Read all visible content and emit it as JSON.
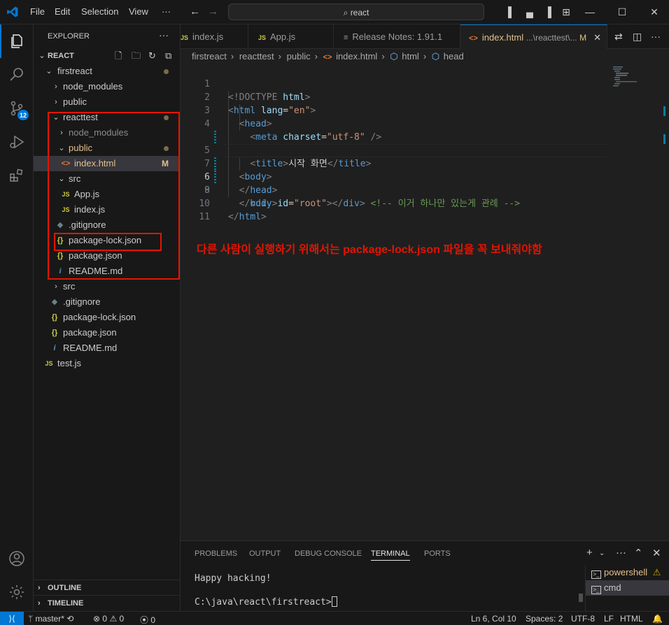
{
  "menu": {
    "file": "File",
    "edit": "Edit",
    "selection": "Selection",
    "view": "View",
    "more": "···"
  },
  "command_center": {
    "text": "react"
  },
  "explorer": {
    "header": "EXPLORER",
    "root": "REACT",
    "tree": [
      {
        "label": "firstreact",
        "dot": true
      },
      {
        "label": "node_modules"
      },
      {
        "label": "public"
      },
      {
        "label": "reacttest",
        "dot": true
      },
      {
        "label": "node_modules"
      },
      {
        "label": "public",
        "dot": true
      },
      {
        "label": "index.html",
        "badge": "M",
        "icon": "<>"
      },
      {
        "label": "src"
      },
      {
        "label": "App.js",
        "icon": "JS"
      },
      {
        "label": "index.js",
        "icon": "JS"
      },
      {
        "label": ".gitignore"
      },
      {
        "label": "package-lock.json",
        "icon": "{}"
      },
      {
        "label": "package.json",
        "icon": "{}"
      },
      {
        "label": "README.md",
        "icon": "i"
      },
      {
        "label": "src"
      },
      {
        "label": ".gitignore"
      },
      {
        "label": "package-lock.json",
        "icon": "{}"
      },
      {
        "label": "package.json",
        "icon": "{}"
      },
      {
        "label": "README.md",
        "icon": "i"
      },
      {
        "label": "test.js",
        "icon": "JS"
      }
    ],
    "outline": "OUTLINE",
    "timeline": "TIMELINE"
  },
  "tabs": [
    {
      "label": "index.js",
      "icon": "JS"
    },
    {
      "label": "App.js",
      "icon": "JS"
    },
    {
      "label": "Release Notes: 1.91.1",
      "icon": "≡"
    },
    {
      "label": "index.html",
      "icon": "<>",
      "path": "...\\reacttest\\...",
      "badge": "M"
    }
  ],
  "breadcrumb": [
    "firstreact",
    "reacttest",
    "public",
    "index.html",
    "html",
    "head"
  ],
  "editor": {
    "line_numbers": [
      "1",
      "2",
      "3",
      "4",
      "5",
      "6",
      "7",
      "8",
      "9",
      "10",
      "11"
    ],
    "current_line": "6",
    "code": {
      "l1_doc": "<!DOCTYPE ",
      "l1_html": "html",
      "l1_close": ">",
      "lang_attr": "lang",
      "lang_val": "\"en\"",
      "charset_attr": "charset",
      "charset_val": "\"utf-8\"",
      "title_text": "시작 화면",
      "id_attr": "id",
      "id_val": "\"root\"",
      "comment": "<!-- 이거 하나만 있는게 관례 -->"
    }
  },
  "annotation": "다른 사람이 실행하기 위해서는 package-lock.json 파일을 꼭 보내줘야함",
  "panel": {
    "tabs": [
      "PROBLEMS",
      "OUTPUT",
      "DEBUG CONSOLE",
      "TERMINAL",
      "PORTS"
    ],
    "active_tab": "TERMINAL",
    "terminal_lines": [
      "Happy hacking!",
      "C:\\java\\react\\firstreact>"
    ],
    "terminals": [
      "powershell",
      "cmd"
    ]
  },
  "statusbar": {
    "branch": "master*",
    "errors": "0",
    "warnings": "0",
    "ports": "0",
    "position": "Ln 6, Col 10",
    "spaces": "Spaces: 2",
    "encoding": "UTF-8",
    "eol": "LF",
    "language": "HTML"
  },
  "activity_badge": "12",
  "colors": {
    "accent": "#0078d4",
    "annotation": "#e51400",
    "modified": "#e2c08d",
    "js_icon": "#cbcb41",
    "json_icon": "#cbcb41",
    "html_icon": "#e37933",
    "info_icon": "#519aba"
  }
}
